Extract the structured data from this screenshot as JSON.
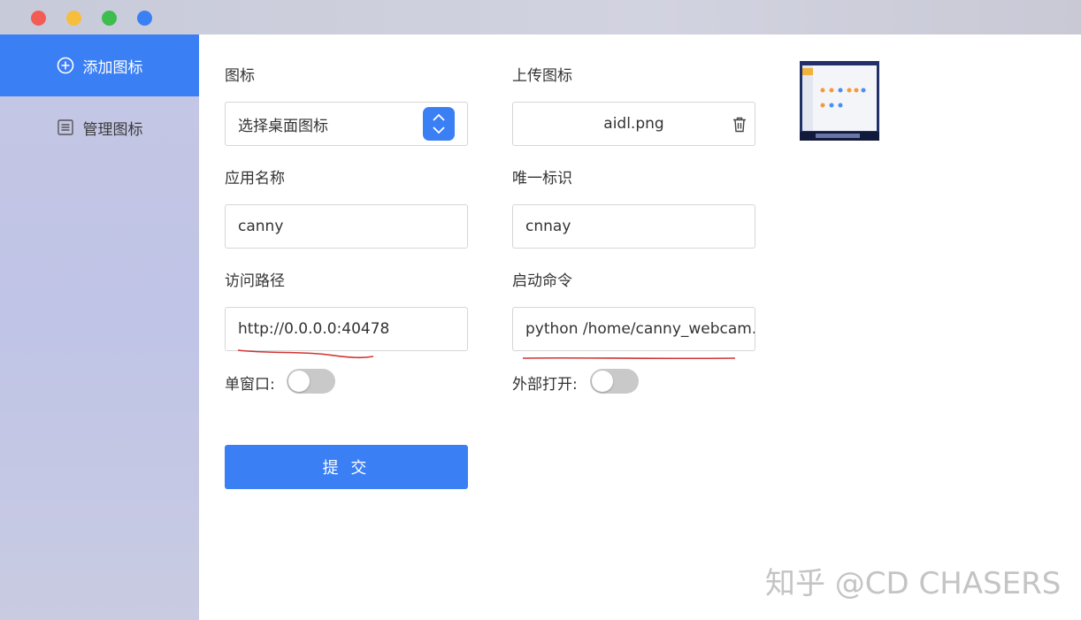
{
  "window": {
    "controls": [
      {
        "name": "close",
        "color": "#f25c54"
      },
      {
        "name": "minimize",
        "color": "#f6be3c"
      },
      {
        "name": "maximize",
        "color": "#3cbd4e"
      },
      {
        "name": "extra",
        "color": "#3b7ff5"
      }
    ]
  },
  "sidebar": {
    "items": [
      {
        "label": "添加图标",
        "icon": "plus-circle-icon",
        "active": true
      },
      {
        "label": "管理图标",
        "icon": "list-icon",
        "active": false
      }
    ]
  },
  "form": {
    "icon": {
      "label": "图标",
      "placeholder": "选择桌面图标",
      "icon": "chevron-up-down-icon"
    },
    "upload": {
      "label": "上传图标",
      "filename": "aidl.png",
      "icon": "trash-icon"
    },
    "app_name": {
      "label": "应用名称",
      "value": "canny"
    },
    "unique_id": {
      "label": "唯一标识",
      "value": "cnnay"
    },
    "access_path": {
      "label": "访问路径",
      "value": "http://0.0.0.0:40478"
    },
    "launch_cmd": {
      "label": "启动命令",
      "value": "python /home/canny_webcam.py"
    },
    "single_window": {
      "label": "单窗口:",
      "checked": false
    },
    "external_open": {
      "label": "外部打开:",
      "checked": false
    },
    "submit_label": "提 交"
  },
  "annotations": {
    "underline_color": "#d03434"
  },
  "watermark": "知乎 @CD CHASERS",
  "colors": {
    "accent": "#3b7ff5"
  }
}
